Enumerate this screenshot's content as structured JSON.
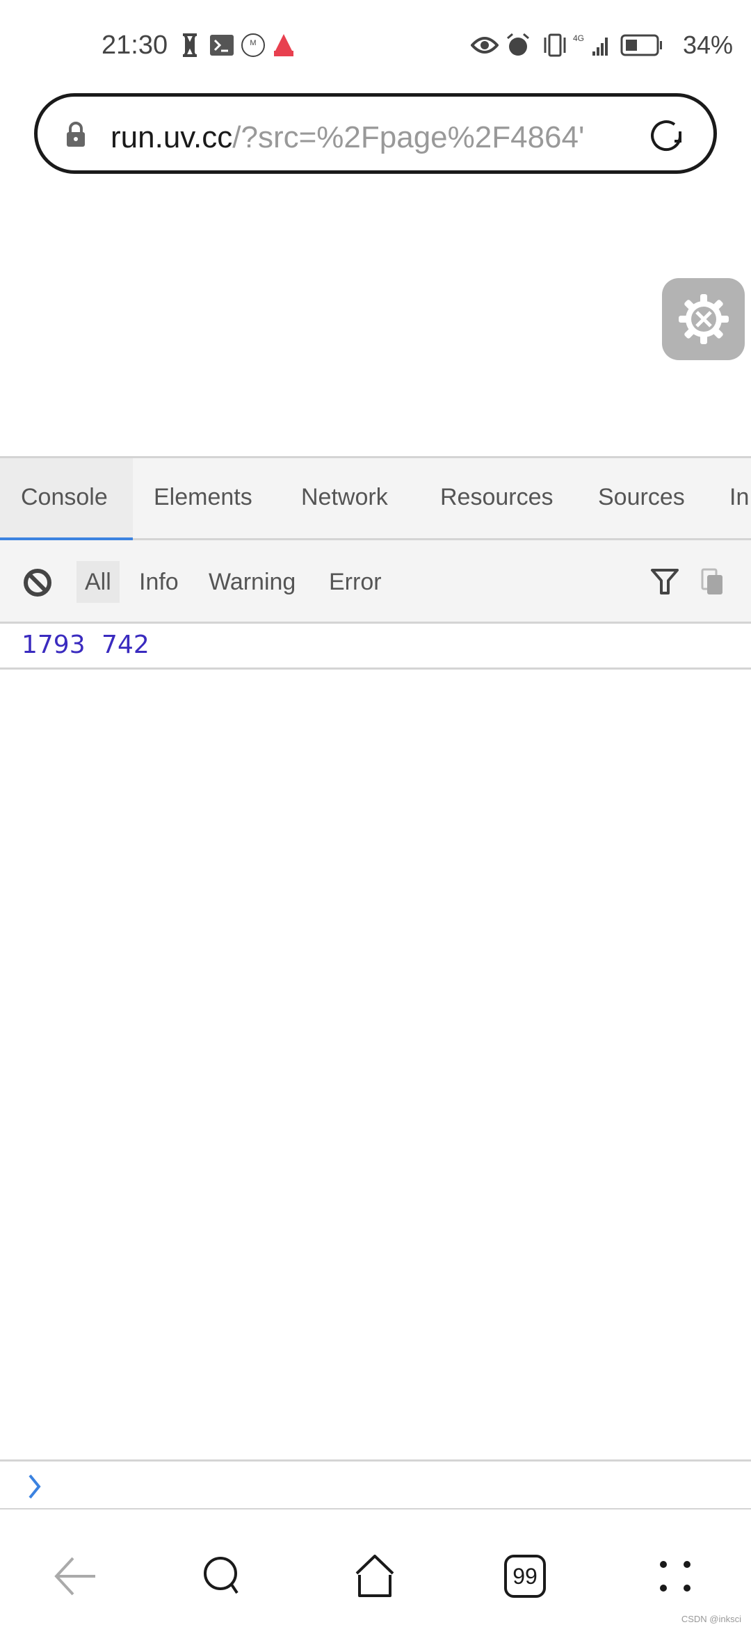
{
  "status_bar": {
    "time": "21:30",
    "battery": "34%",
    "network": "4G",
    "icons_left": [
      "hourglass-icon",
      "terminal-icon",
      "jd-app-icon",
      "app-notification-icon"
    ],
    "icons_right": [
      "eye-icon",
      "alarm-icon",
      "vibrate-icon",
      "signal-icon",
      "battery-icon"
    ]
  },
  "address_bar": {
    "host": "run.uv.cc",
    "path": "/?src=%2Fpage%2F4864'",
    "lock_icon": "lock-icon",
    "reload_icon": "reload-icon"
  },
  "devtools_toggle": {
    "icon": "gear-wrench-icon"
  },
  "devtools": {
    "tabs": [
      {
        "label": "Console",
        "active": true
      },
      {
        "label": "Elements"
      },
      {
        "label": "Network"
      },
      {
        "label": "Resources"
      },
      {
        "label": "Sources"
      },
      {
        "label": "In"
      }
    ],
    "filters": [
      {
        "label": "All",
        "selected": true
      },
      {
        "label": "Info"
      },
      {
        "label": "Warning"
      },
      {
        "label": "Error"
      }
    ],
    "log": [
      "1793 742"
    ],
    "log_color": "#3a2bbf",
    "accent": "#3b82e0"
  },
  "nav": {
    "tabs_count": "99"
  },
  "watermark": "CSDN @inksci"
}
